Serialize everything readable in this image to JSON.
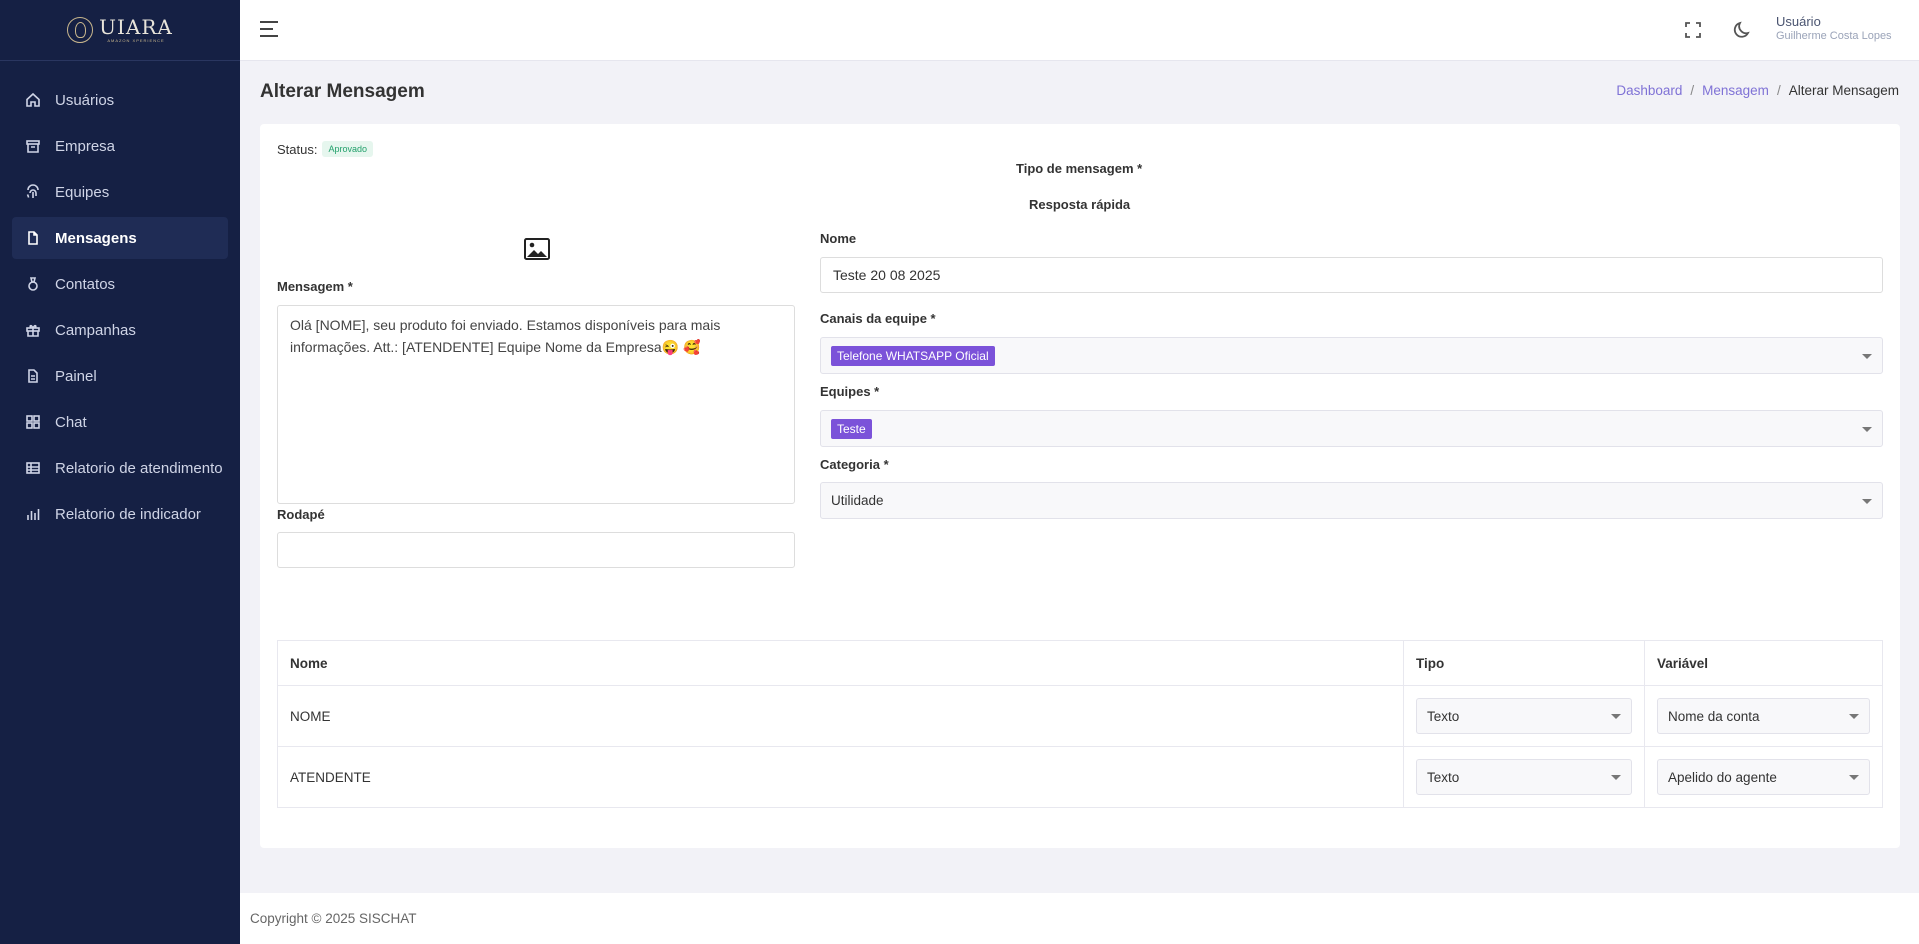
{
  "brand": {
    "name": "UIARA",
    "subtitle": "AMAZON XPERIENCE"
  },
  "sidebar": {
    "items": [
      {
        "label": "Usuários",
        "icon": "home-icon"
      },
      {
        "label": "Empresa",
        "icon": "archive-icon"
      },
      {
        "label": "Equipes",
        "icon": "fingerprint-icon"
      },
      {
        "label": "Mensagens",
        "icon": "file-icon",
        "active": true
      },
      {
        "label": "Contatos",
        "icon": "medal-icon"
      },
      {
        "label": "Campanhas",
        "icon": "gift-icon"
      },
      {
        "label": "Painel",
        "icon": "document-icon"
      },
      {
        "label": "Chat",
        "icon": "grid-icon"
      },
      {
        "label": "Relatorio de atendimento",
        "icon": "table-icon"
      },
      {
        "label": "Relatorio de indicador",
        "icon": "bar-chart-icon"
      }
    ]
  },
  "topbar": {
    "user_name": "Usuário",
    "user_subtitle": "Guilherme Costa Lopes"
  },
  "page": {
    "title": "Alterar Mensagem",
    "breadcrumb": {
      "home": "Dashboard",
      "section": "Mensagem",
      "current": "Alterar Mensagem",
      "separator": "/"
    }
  },
  "form": {
    "status_label": "Status:",
    "status_value": "Aprovado",
    "type_label": "Tipo de mensagem *",
    "type_value": "Resposta rápida",
    "message_label": "Mensagem *",
    "message_value": "Olá [NOME], seu produto foi enviado. Estamos disponíveis para mais informações. Att.: [ATENDENTE] Equipe Nome da Empresa😜 🥰",
    "footer_label": "Rodapé",
    "footer_value": "",
    "name_label": "Nome",
    "name_value": "Teste 20 08 2025",
    "channels_label": "Canais da equipe *",
    "channels_tag": "Telefone WHATSAPP Oficial",
    "teams_label": "Equipes *",
    "teams_tag": "Teste",
    "category_label": "Categoria *",
    "category_value": "Utilidade"
  },
  "variables_table": {
    "headers": {
      "name": "Nome",
      "type": "Tipo",
      "variable": "Variável"
    },
    "rows": [
      {
        "name": "NOME",
        "type": "Texto",
        "variable": "Nome da conta"
      },
      {
        "name": "ATENDENTE",
        "type": "Texto",
        "variable": "Apelido do agente"
      }
    ]
  },
  "footer": {
    "copyright": "Copyright © 2025 SISCHAT"
  },
  "colors": {
    "sidebar_bg": "#152044",
    "accent": "#7b52d9",
    "link": "#7f72d6",
    "success": "#22a06b"
  }
}
